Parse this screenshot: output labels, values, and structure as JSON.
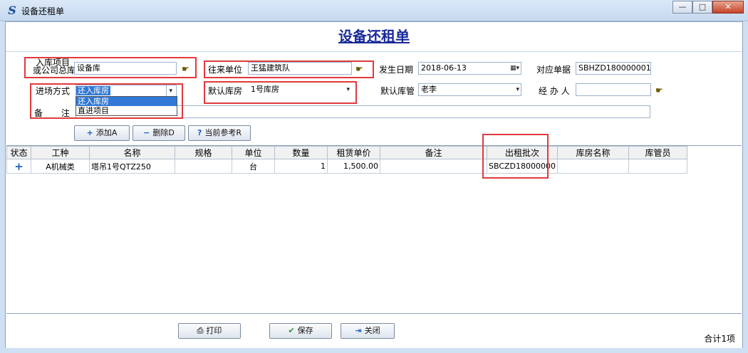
{
  "window": {
    "title": "设备还租单",
    "min": "—",
    "max": "□",
    "close": "✕"
  },
  "form_title": "设备还租单",
  "fields": {
    "warehouse_label_1": "入库项目",
    "warehouse_label_2": "或公司总库",
    "warehouse_value": "设备库",
    "partner_label": "往来单位",
    "partner_value": "王猛建筑队",
    "date_label": "发生日期",
    "date_value": "2018-06-13",
    "ref_label": "对应单据",
    "ref_value": "SBHZD180000001",
    "entry_mode_label": "进场方式",
    "entry_mode_value": "还入库房",
    "default_store_label": "默认库房",
    "default_store_value": "1号库房",
    "default_keeper_label": "默认库管",
    "default_keeper_value": "老李",
    "handler_label": "经 办 人",
    "handler_value": "",
    "remark_label_1": "备",
    "remark_label_2": "注",
    "remark_value": ""
  },
  "entry_mode_options": [
    "还入库房",
    "直进项目"
  ],
  "toolbar": {
    "add": "添加A",
    "delete": "删除D",
    "reference": "当前参考R"
  },
  "table": {
    "columns": [
      "状态",
      "工种",
      "名称",
      "规格",
      "单位",
      "数量",
      "租赁单价",
      "备注",
      "出租批次",
      "库房名称",
      "库管员"
    ],
    "rows": [
      {
        "status": "+",
        "type": "A机械类",
        "name": "塔吊1号QTZ250",
        "spec": "",
        "unit": "台",
        "qty": "1",
        "price": "1,500.00",
        "remark": "",
        "batch": "SBCZD18000000",
        "store": "",
        "keeper": ""
      }
    ]
  },
  "footer": {
    "print": "打印",
    "save": "保存",
    "close": "关闭",
    "total": "合计1项"
  },
  "colors": {
    "title_blue": "#1a2a9a",
    "highlight_red": "#e0393e",
    "selection_blue": "#3178d6"
  }
}
